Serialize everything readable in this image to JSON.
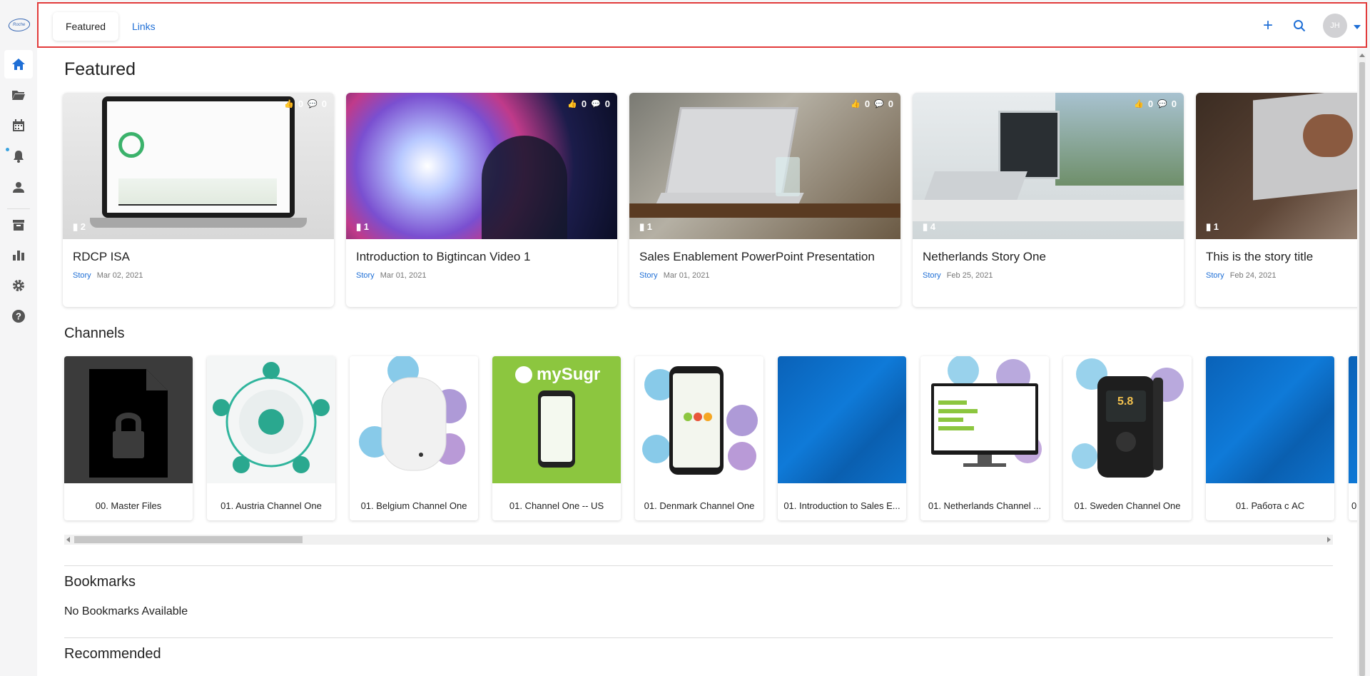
{
  "brand": {
    "logo_text": "Roche"
  },
  "sidebar": {
    "items": [
      {
        "name": "home-icon",
        "active": true
      },
      {
        "name": "folder-icon"
      },
      {
        "name": "calendar-icon"
      },
      {
        "name": "bell-icon"
      },
      {
        "name": "user-icon"
      },
      {
        "name": "archive-icon"
      },
      {
        "name": "bar-chart-icon"
      },
      {
        "name": "gear-icon"
      },
      {
        "name": "help-icon"
      }
    ]
  },
  "topbar": {
    "tabs": [
      {
        "label": "Featured",
        "active": true
      },
      {
        "label": "Links",
        "active": false
      }
    ],
    "add_label": "+",
    "avatar_initials": "JH",
    "accent": "#1f6fd6"
  },
  "sections": {
    "featured": "Featured",
    "channels": "Channels",
    "bookmarks": "Bookmarks",
    "bookmarks_empty": "No Bookmarks Available",
    "recommended": "Recommended"
  },
  "featured": [
    {
      "title": "RDCP ISA",
      "type": "Story",
      "date": "Mar 02, 2021",
      "likes": "0",
      "comments": "0",
      "pages": "2"
    },
    {
      "title": "Introduction to Bigtincan Video 1",
      "type": "Story",
      "date": "Mar 01, 2021",
      "likes": "0",
      "comments": "0",
      "pages": "1"
    },
    {
      "title": "Sales Enablement PowerPoint Presentation",
      "type": "Story",
      "date": "Mar 01, 2021",
      "likes": "0",
      "comments": "0",
      "pages": "1"
    },
    {
      "title": "Netherlands Story One",
      "type": "Story",
      "date": "Feb 25, 2021",
      "likes": "0",
      "comments": "0",
      "pages": "4"
    },
    {
      "title": "This is the story title",
      "type": "Story",
      "date": "Feb 24, 2021",
      "likes": "",
      "comments": "",
      "pages": "1"
    }
  ],
  "channels": [
    {
      "label": "00. Master Files"
    },
    {
      "label": "01. Austria Channel One"
    },
    {
      "label": "01. Belgium Channel One"
    },
    {
      "label": "01. Channel One -- US",
      "brand": "mySugr"
    },
    {
      "label": "01. Denmark Channel One"
    },
    {
      "label": "01. Introduction to Sales E..."
    },
    {
      "label": "01. Netherlands Channel ..."
    },
    {
      "label": "01. Sweden Channel One",
      "device_reading": "5.8"
    },
    {
      "label": "01. Работа с AC"
    },
    {
      "label": "0"
    }
  ]
}
